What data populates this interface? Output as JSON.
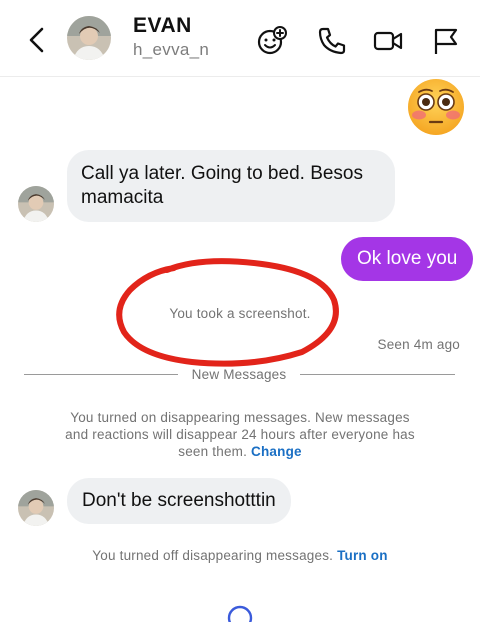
{
  "header": {
    "name": "EVAN",
    "username": "h_evva_n",
    "icons": [
      "back-chevron-icon",
      "avatar",
      "sticker-add-icon",
      "phone-icon",
      "video-camera-icon",
      "flag-icon"
    ]
  },
  "messages": {
    "emoji": "😳",
    "incoming_1": {
      "line1": "Call ya later.  Going to bed.  Besos",
      "line2": "mamacita"
    },
    "outgoing_1": "Ok love you",
    "screenshot_notice": "You took a screenshot.",
    "seen": "Seen 4m ago",
    "divider": "New Messages",
    "disappearing_on": {
      "line1": "You turned on disappearing messages. New messages",
      "line2": "and reactions will disappear 24 hours after everyone has",
      "line3": "seen them.",
      "link": "Change"
    },
    "incoming_2": "Don't be screenshotttin",
    "disappearing_off": {
      "text": "You turned off disappearing messages.",
      "link": "Turn on"
    }
  },
  "colors": {
    "outgoing_bubble": "#a436e6",
    "incoming_bubble": "#eef0f2",
    "link": "#1a6fc4",
    "annotation": "#e2241a"
  }
}
